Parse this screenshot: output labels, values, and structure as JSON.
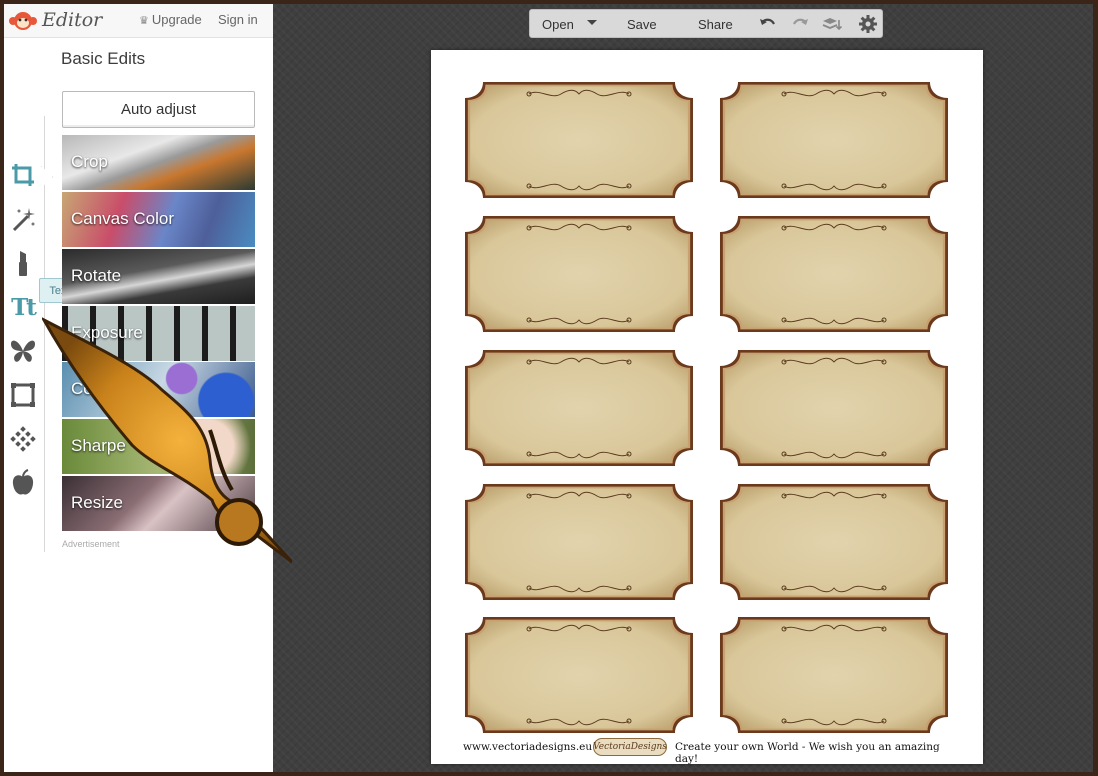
{
  "app": {
    "logo_text": "Editor",
    "upgrade_label": "Upgrade",
    "signin_label": "Sign in"
  },
  "panel": {
    "section_title": "Basic Edits",
    "auto_adjust_label": "Auto adjust",
    "tooltip_text": "Text",
    "tools": [
      {
        "name": "crop",
        "icon": "crop-icon"
      },
      {
        "name": "effects",
        "icon": "magic-wand-icon"
      },
      {
        "name": "touch-up",
        "icon": "lipstick-icon"
      },
      {
        "name": "text",
        "icon": "text-icon",
        "glyph": "Tt"
      },
      {
        "name": "overlays",
        "icon": "butterfly-icon"
      },
      {
        "name": "frames",
        "icon": "frame-icon"
      },
      {
        "name": "textures",
        "icon": "texture-icon"
      },
      {
        "name": "seasonal",
        "icon": "apple-icon"
      }
    ],
    "edits": [
      {
        "label": "Crop"
      },
      {
        "label": "Canvas Color"
      },
      {
        "label": "Rotate"
      },
      {
        "label": "Exposure"
      },
      {
        "label": "Col"
      },
      {
        "label": "Sharpe"
      },
      {
        "label": "Resize"
      }
    ],
    "ad_label": "Advertisement"
  },
  "toolbar": {
    "open_label": "Open",
    "save_label": "Save",
    "share_label": "Share"
  },
  "canvas": {
    "footer_left": "www.vectoriadesigns.eu",
    "footer_logo": "VectoriaDesigns",
    "footer_right": "Create your own World - We wish you an amazing day!"
  },
  "colors": {
    "accent": "#4a9aa8",
    "workspace": "#3f3f3f",
    "parchment": "#d9c79a",
    "label_border": "#6b3a1c"
  }
}
